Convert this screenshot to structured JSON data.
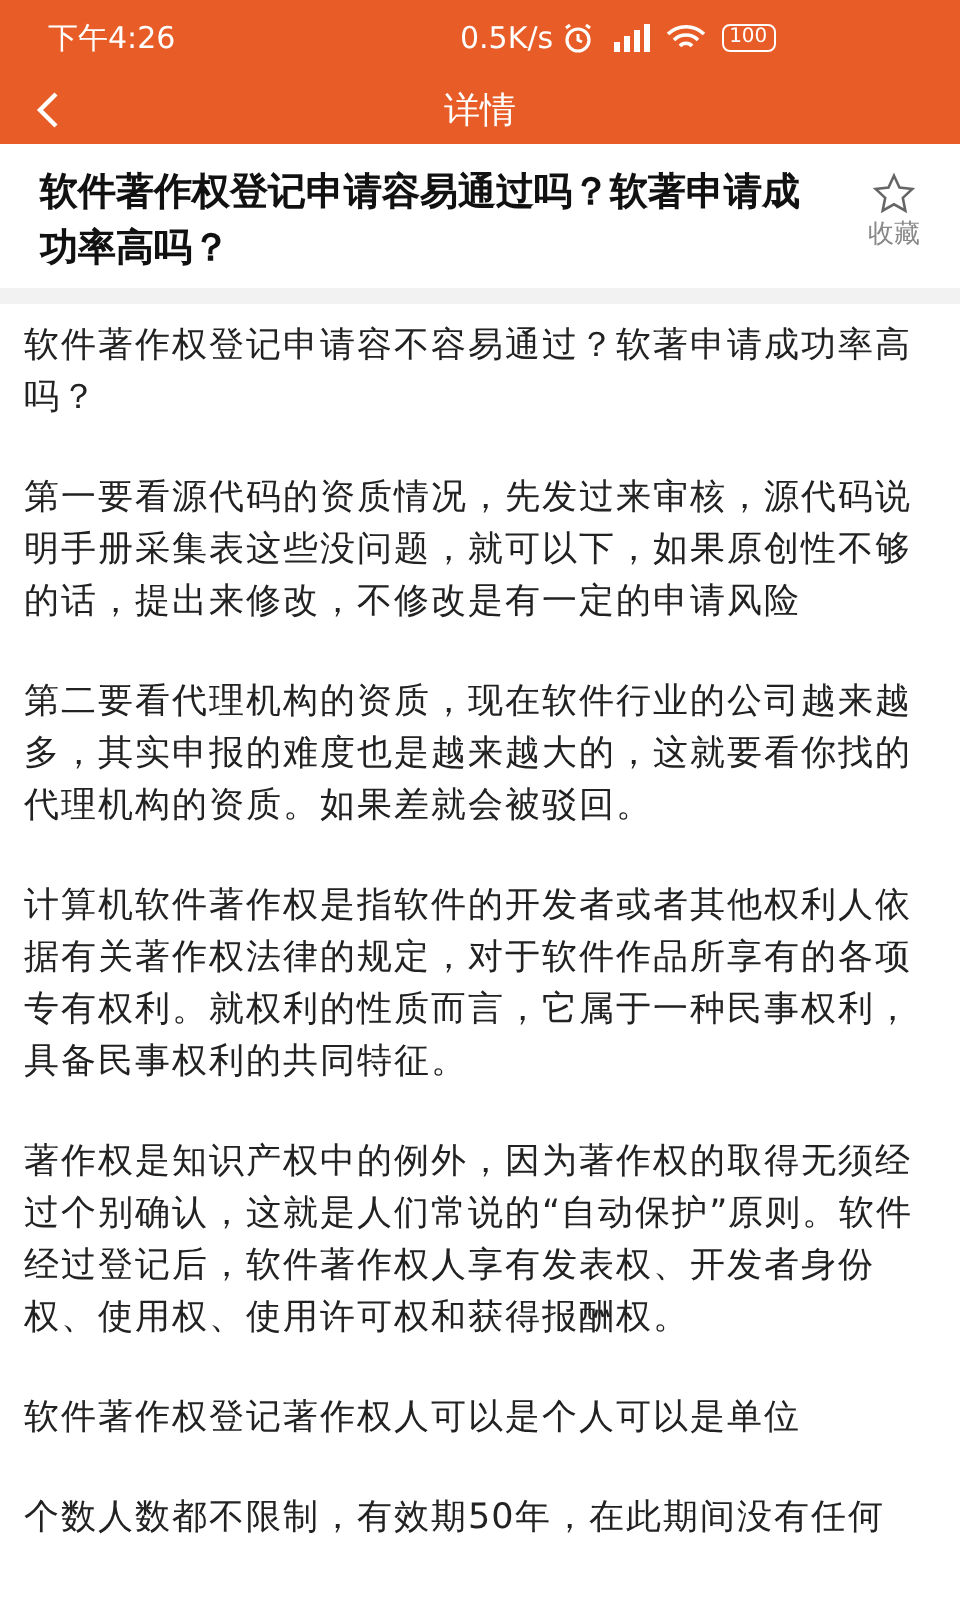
{
  "status_bar": {
    "time": "下午4:26",
    "speed": "0.5K/s",
    "battery": "100"
  },
  "nav": {
    "title": "详情"
  },
  "article": {
    "title": "软件著作权登记申请容易通过吗？软著申请成功率高吗？",
    "favorite": {
      "label": "收藏",
      "selected": false
    }
  },
  "paragraphs": [
    "软件著作权登记申请容不容易通过？软著申请成功率高吗？",
    "第一要看源代码的资质情况，先发过来审核，源代码说明手册采集表这些没问题，就可以下，如果原创性不够的话，提出来修改，不修改是有一定的申请风险",
    "第二要看代理机构的资质，现在软件行业的公司越来越多，其实申报的难度也是越来越大的，这就要看你找的代理机构的资质。如果差就会被驳回。",
    "计算机软件著作权是指软件的开发者或者其他权利人依据有关著作权法律的规定，对于软件作品所享有的各项专有权利。就权利的性质而言，它属于一种民事权利，具备民事权利的共同特征。",
    "著作权是知识产权中的例外，因为著作权的取得无须经过个别确认，这就是人们常说的“自动保护”原则。软件经过登记后，软件著作权人享有发表权、开发者身份权、使用权、使用许可权和获得报酬权。",
    "软件著作权登记著作权人可以是个人可以是单位",
    "个数人数都不限制，有效期50年，在此期间没有任何"
  ]
}
